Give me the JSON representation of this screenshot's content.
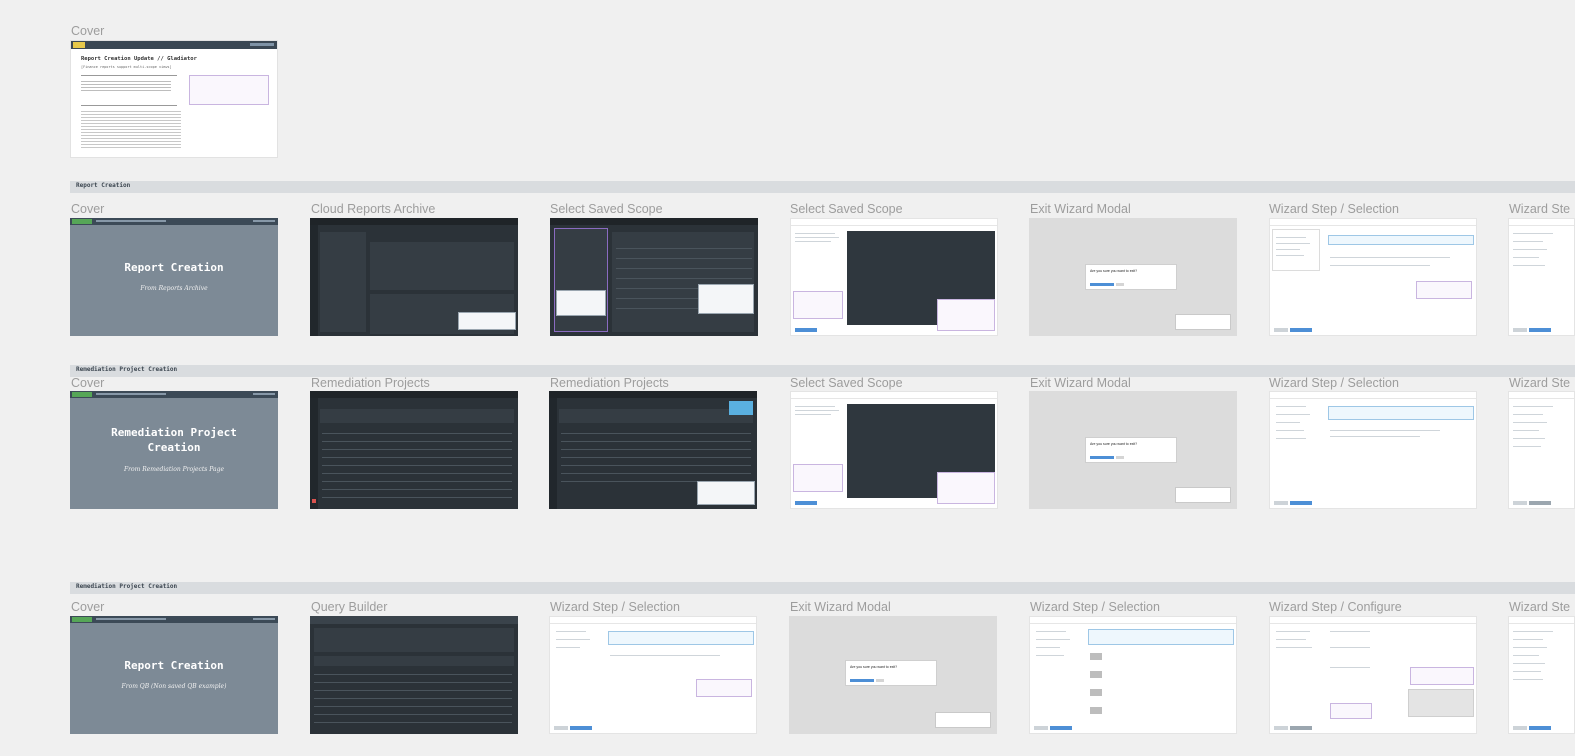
{
  "row0": {
    "label": "Cover",
    "doc_title": "Report Creation Update // Gladiator",
    "doc_subtitle": "[Finance reports support multi-scope views]"
  },
  "sections": [
    {
      "title": "Report Creation"
    },
    {
      "title": "Remediation Project Creation"
    },
    {
      "title": "Remediation Project Creation"
    }
  ],
  "row1": {
    "labels": [
      "Cover",
      "Cloud Reports Archive",
      "Select Saved Scope",
      "Select Saved Scope",
      "Exit Wizard Modal",
      "Wizard Step / Selection",
      "Wizard Ste"
    ],
    "cover_title": "Report Creation",
    "cover_sub": "From Reports Archive"
  },
  "row2": {
    "labels": [
      "Cover",
      "Remediation Projects",
      "Remediation Projects",
      "Select Saved Scope",
      "Exit Wizard Modal",
      "Wizard Step / Selection",
      "Wizard Ste"
    ],
    "cover_title": "Remediation Project Creation",
    "cover_sub": "From Remediation Projects Page"
  },
  "row3": {
    "labels": [
      "Cover",
      "Query Builder",
      "Wizard Step / Selection",
      "Exit Wizard Modal",
      "Wizard Step / Selection",
      "Wizard Step / Configure",
      "Wizard Ste"
    ],
    "cover_title": "Report Creation",
    "cover_sub": "From QB (Non saved QB example)"
  },
  "modal": {
    "question": "Are you sure you want to exit?"
  }
}
